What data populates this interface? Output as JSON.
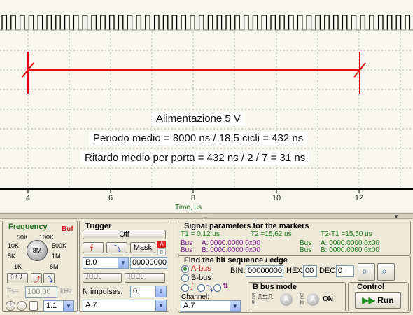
{
  "display": {
    "annotations": [
      "Alimentazione 5 V",
      "Periodo medio = 8000 ns / 18,5 cicli = 432 ns",
      "Ritardo medio per porta = 432 ns / 2 / 7 = 31 ns"
    ],
    "ticks": [
      "4",
      "6",
      "8",
      "10",
      "12"
    ],
    "axis_label": "Time, us",
    "signal_color": "#000000",
    "marker_color": "#e01010",
    "grid_color": "#b0b0b0"
  },
  "frequency": {
    "title": "Frequency",
    "buf": "Buf",
    "knob_labels": [
      "50K",
      "100K",
      "10K",
      "500K",
      "5K",
      "1M",
      "1K",
      "8M"
    ],
    "knob_value": "8M",
    "fs_label": "Fs=",
    "fs_value": "100,00",
    "fs_unit": "kHz",
    "zoom_value": "1:1"
  },
  "trigger": {
    "title": "Trigger",
    "state_button": "Off",
    "mask_button": "Mask",
    "a_badge": "A",
    "b_badge": "B",
    "channel_value": "B.0",
    "pattern_value": "00000000",
    "n_impulses_label": "N impulses:",
    "n_impulses_value": "0",
    "channel2_value": "A.7"
  },
  "signal": {
    "title": "Signal parameters for the markers",
    "t1": "T1 = 0,12 us",
    "t2": "T2 =15,62 us",
    "dt": "T2-T1 =15,50 us",
    "bus_label": "Bus",
    "bus1_a": "A: 0000.0000 0x00",
    "bus1_b": "B: 0000.0000 0x00",
    "bus2_a": "A: 0000.0000 0x00",
    "bus2_b": "B: 0000.0000 0x00"
  },
  "find": {
    "title": "Find the bit sequence / edge",
    "a_bus": "A-bus",
    "b_bus": "B-bus",
    "bin_label": "BIN:",
    "bin_value": "00000000",
    "hex_label": "HEX:",
    "hex_value": "00",
    "dec_label": "DEC:",
    "dec_value": "0",
    "channel_label": "Channel:",
    "channel_value": "A.7"
  },
  "bmode": {
    "title": "B bus mode",
    "bus_tag": "BUSB",
    "a_toggle": "A",
    "on_label": "ON"
  },
  "control": {
    "title": "Control",
    "run_label": "Run"
  }
}
